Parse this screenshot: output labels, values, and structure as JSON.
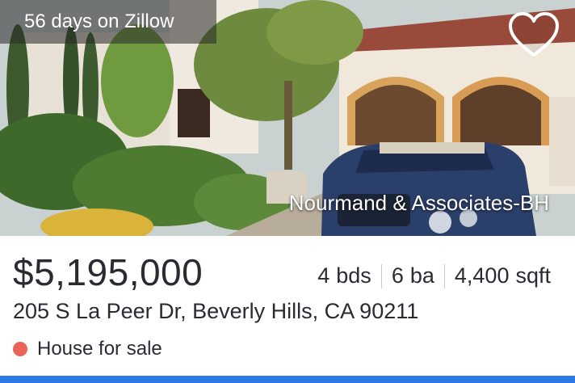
{
  "listing": {
    "days_on_market": "56 days on Zillow",
    "agency": "Nourmand & Associates-BH",
    "price": "$5,195,000",
    "beds": "4",
    "beds_unit": "bds",
    "baths": "6",
    "baths_unit": "ba",
    "sqft": "4,400",
    "sqft_unit": "sqft",
    "address": "205 S La Peer Dr, Beverly Hills, CA 90211",
    "status": "House for sale",
    "status_color": "#e86457"
  },
  "icons": {
    "favorite": "heart-outline-icon"
  },
  "colors": {
    "accent_bar": "#2e79e6",
    "text": "#2a2a33"
  }
}
